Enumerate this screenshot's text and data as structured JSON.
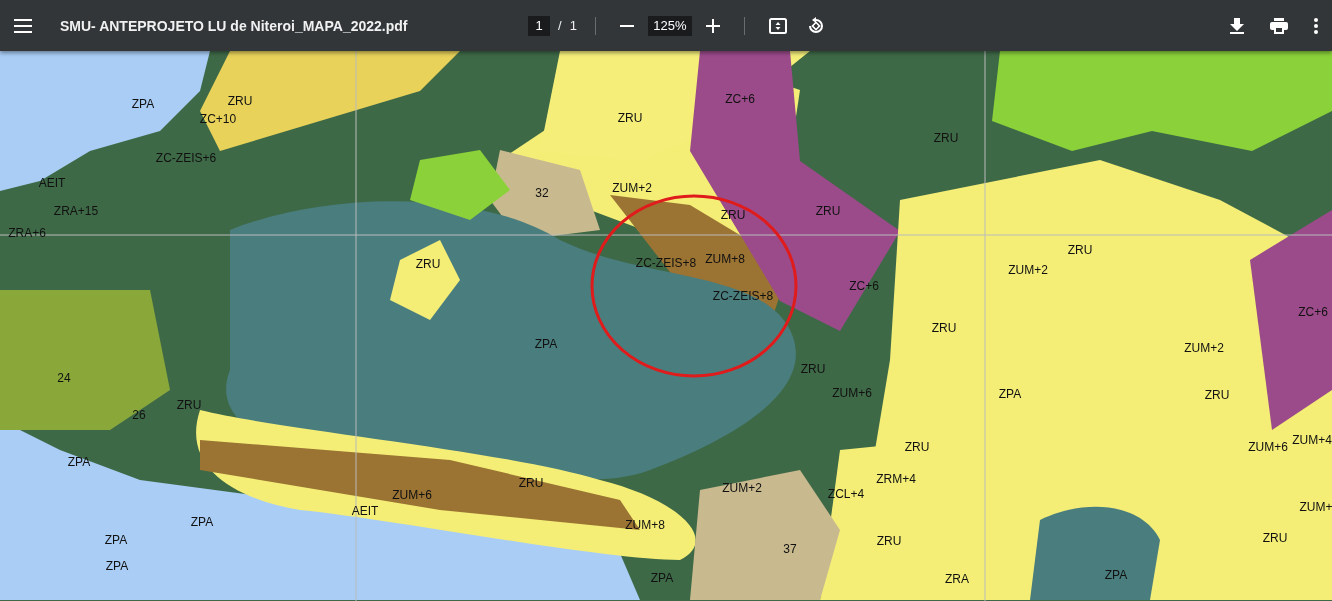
{
  "toolbar": {
    "title": "SMU- ANTEPROJETO LU de Niteroi_MAPA_2022.pdf",
    "page_current": "1",
    "page_separator": "/",
    "page_total": "1",
    "zoom": "125%"
  },
  "map": {
    "labels": [
      {
        "text": "ZPA"
      },
      {
        "text": "ZRU"
      },
      {
        "text": "ZC+6"
      },
      {
        "text": "ZC+10"
      },
      {
        "text": "ZRU"
      },
      {
        "text": "ZRU"
      },
      {
        "text": "ZC-ZEIS+6"
      },
      {
        "text": "AEIT"
      },
      {
        "text": "32"
      },
      {
        "text": "ZUM+2"
      },
      {
        "text": "ZRA+15"
      },
      {
        "text": "ZRU"
      },
      {
        "text": "ZRU"
      },
      {
        "text": "ZRA+6"
      },
      {
        "text": "ZRU"
      },
      {
        "text": "ZC-ZEIS+8"
      },
      {
        "text": "ZUM+8"
      },
      {
        "text": "ZRU"
      },
      {
        "text": "ZUM+2"
      },
      {
        "text": "ZC-ZEIS+8"
      },
      {
        "text": "ZC+6"
      },
      {
        "text": "ZC+6"
      },
      {
        "text": "ZRU"
      },
      {
        "text": "ZPA"
      },
      {
        "text": "ZUM+2"
      },
      {
        "text": "24"
      },
      {
        "text": "ZRU"
      },
      {
        "text": "ZUM+6"
      },
      {
        "text": "ZPA"
      },
      {
        "text": "ZRU"
      },
      {
        "text": "26"
      },
      {
        "text": "ZRU"
      },
      {
        "text": "ZRU"
      },
      {
        "text": "ZUM+6"
      },
      {
        "text": "ZUM+4"
      },
      {
        "text": "ZPA"
      },
      {
        "text": "ZRU"
      },
      {
        "text": "ZUM+2"
      },
      {
        "text": "ZRM+4"
      },
      {
        "text": "ZUM+6"
      },
      {
        "text": "ZCL+4"
      },
      {
        "text": "AEIT"
      },
      {
        "text": "ZUM+"
      },
      {
        "text": "ZPA"
      },
      {
        "text": "ZUM+8"
      },
      {
        "text": "ZPA"
      },
      {
        "text": "37"
      },
      {
        "text": "ZRU"
      },
      {
        "text": "ZRU"
      },
      {
        "text": "ZPA"
      },
      {
        "text": "ZPA"
      },
      {
        "text": "ZRA"
      },
      {
        "text": "ZPA"
      }
    ]
  }
}
